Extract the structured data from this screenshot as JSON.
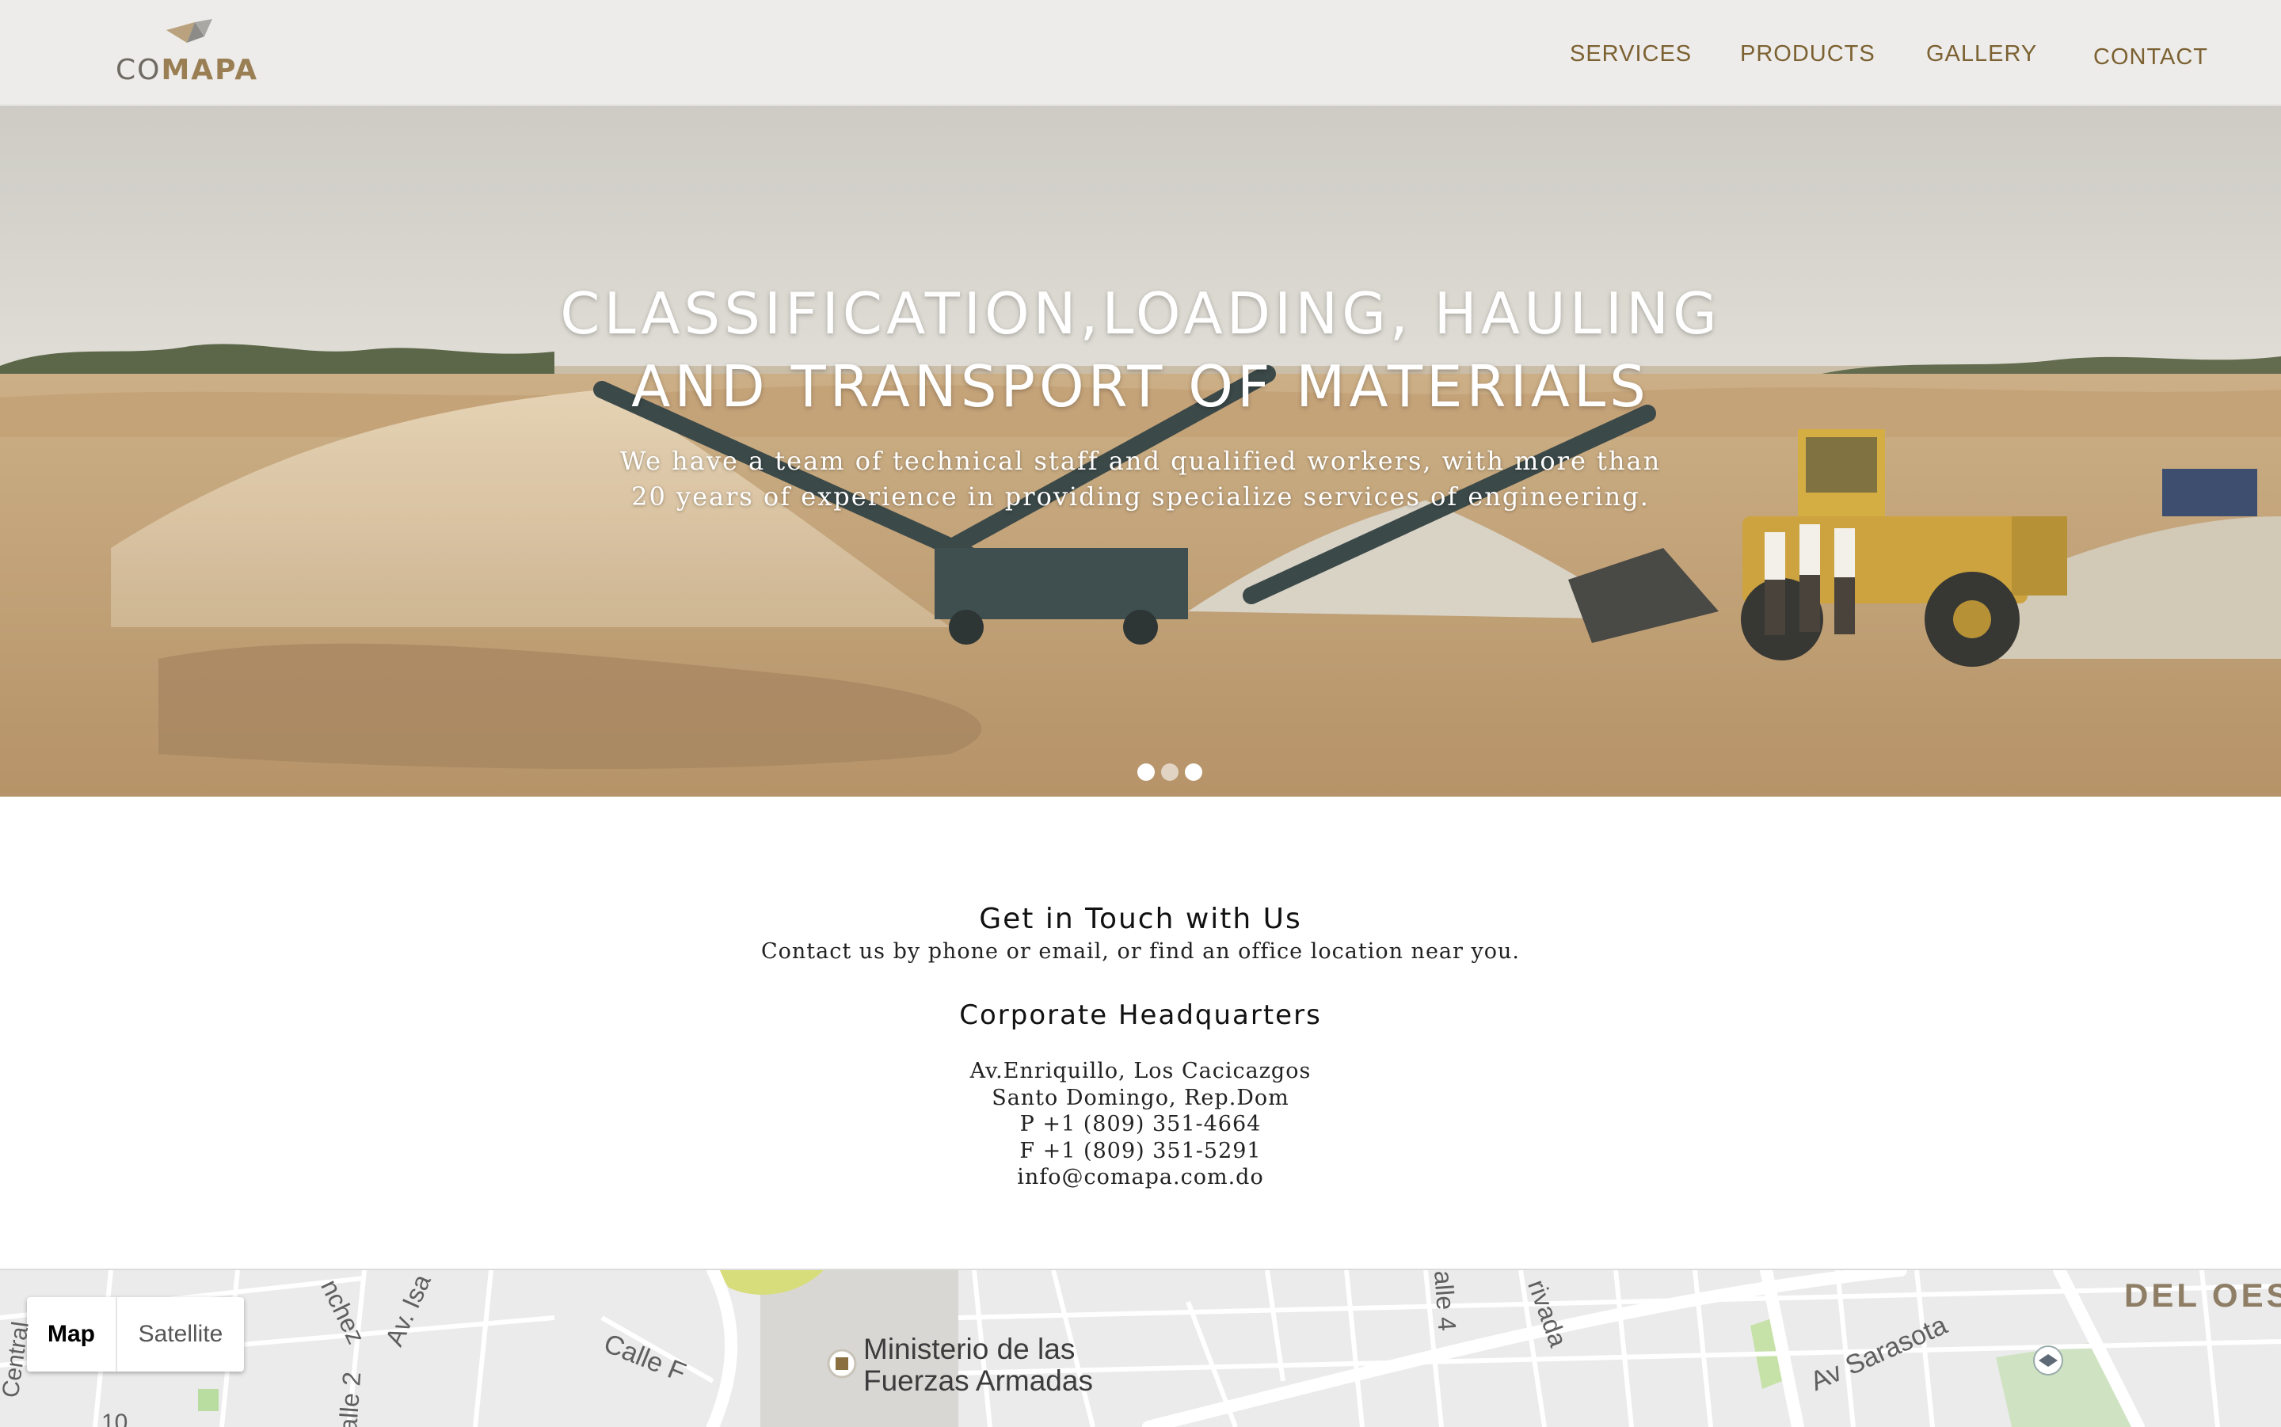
{
  "header": {
    "logo": {
      "co": "CO",
      "mapa": "MAPA"
    },
    "nav": [
      {
        "label": "SERVICES"
      },
      {
        "label": "PRODUCTS"
      },
      {
        "label": "GALLERY"
      },
      {
        "label": "CONTACT"
      }
    ],
    "colors": {
      "nav": "#7c6132",
      "background": "#edecea",
      "brand": "#9a7f55"
    }
  },
  "hero": {
    "title_lines": [
      "CLASSIFICATION,LOADING, HAULING",
      "AND TRANSPORT OF MATERIALS"
    ],
    "subtitle_lines": [
      "We have a team of technical staff and qualified workers, with more than",
      "20 years of experience in providing specialize services of engineering."
    ],
    "slider": {
      "slide_count": 3,
      "active_index": 0
    }
  },
  "contact": {
    "title": "Get in Touch with Us",
    "subtitle": "Contact us by phone or email, or find an office location near you.",
    "hq_title": "Corporate Headquarters",
    "address_line1": "Av.Enriquillo, Los Cacicazgos",
    "address_line2": "Santo Domingo, Rep.Dom",
    "phone": "P +1 (809) 351-4664",
    "fax": "F +1 (809) 351-5291",
    "email": "info@comapa.com.do"
  },
  "map": {
    "toggle": {
      "map_label": "Map",
      "satellite_label": "Satellite",
      "selected": "Map"
    },
    "labels": {
      "poi_line1": "Ministerio de las",
      "poi_line2": "Fuerzas Armadas",
      "street_calle_f": "Calle F",
      "street_sarasota": "Av Sarasota",
      "street_nchez": "nchez",
      "street_av_isa": "Av. Isa",
      "street_alle2": "alle 2",
      "street_alle4": "alle 4",
      "street_rivada": "rivada",
      "street_central": "Central",
      "number_10": "10",
      "district": "DEL OES"
    }
  }
}
